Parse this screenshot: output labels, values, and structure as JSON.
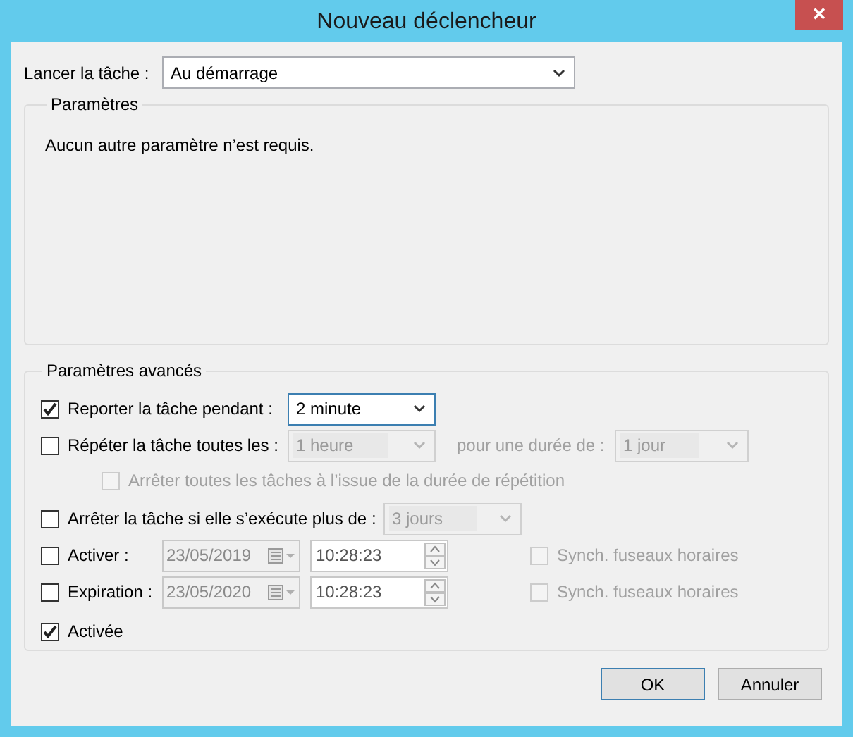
{
  "window": {
    "title": "Nouveau déclencheur",
    "close": "×"
  },
  "launch": {
    "label": "Lancer la tâche :",
    "value": "Au démarrage"
  },
  "parameters": {
    "title": "Paramètres",
    "text": "Aucun autre paramètre n’est requis."
  },
  "advanced": {
    "title": "Paramètres avancés",
    "delay": {
      "label": "Reporter la tâche pendant :",
      "checked": true,
      "value": "2 minute",
      "disabled": false
    },
    "repeat": {
      "label": "Répéter la tâche toutes les :",
      "checked": false,
      "value": "1 heure",
      "disabled": true,
      "duration_label": "pour une durée de :",
      "duration_value": "1 jour"
    },
    "stop_all": {
      "label": "Arrêter toutes les tâches à l’issue de la durée de répétition",
      "checked": false,
      "disabled": true
    },
    "stop_if": {
      "label": "Arrêter la tâche si elle s’exécute plus de :",
      "checked": false,
      "value": "3 jours",
      "disabled": true
    },
    "dates": [
      {
        "label": "Activer :",
        "checked": false,
        "date": "23/05/2019",
        "time": "10:28:23",
        "sync_label": "Synch. fuseaux horaires",
        "sync_checked": false
      },
      {
        "label": "Expiration :",
        "checked": false,
        "date": "23/05/2020",
        "time": "10:28:23",
        "sync_label": "Synch. fuseaux horaires",
        "sync_checked": false
      }
    ],
    "enabled": {
      "label": "Activée",
      "checked": true
    }
  },
  "buttons": [
    {
      "label": "OK",
      "kind": "default"
    },
    {
      "label": "Annuler",
      "kind": "normal"
    }
  ]
}
